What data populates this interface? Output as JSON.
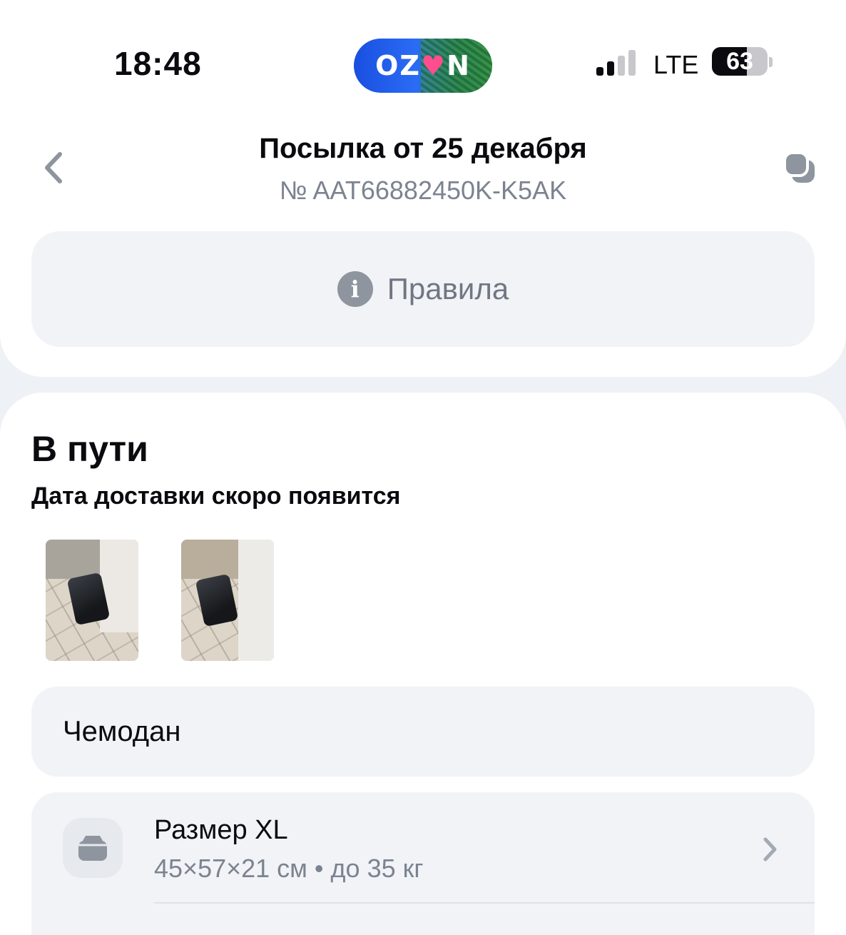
{
  "status_bar": {
    "time": "18:48",
    "network": "LTE",
    "battery": "63",
    "battery_level": 0.63,
    "signal_bars_active": 2,
    "signal_bars_total": 4,
    "logo_text_left": "OZ",
    "logo_heart": "♥",
    "logo_text_right": "N"
  },
  "header": {
    "title": "Посылка от 25 декабря",
    "subtitle": "№ AAT66882450K-K5AK",
    "back_icon": "chevron-left-icon",
    "copy_icon": "copy-icon"
  },
  "rules": {
    "label": "Правила",
    "icon": "info-icon"
  },
  "shipment": {
    "status": "В пути",
    "delivery_note": "Дата доставки скоро появится",
    "photos": [
      "photo-1",
      "photo-2"
    ]
  },
  "item": {
    "name": "Чемодан"
  },
  "size": {
    "title": "Размер XL",
    "detail": "45×57×21 см • до 35 кг",
    "icon": "box-icon"
  },
  "colors": {
    "background": "#eef1f5",
    "card": "#ffffff",
    "panel": "#f1f3f7",
    "muted_text": "#7c8390"
  }
}
